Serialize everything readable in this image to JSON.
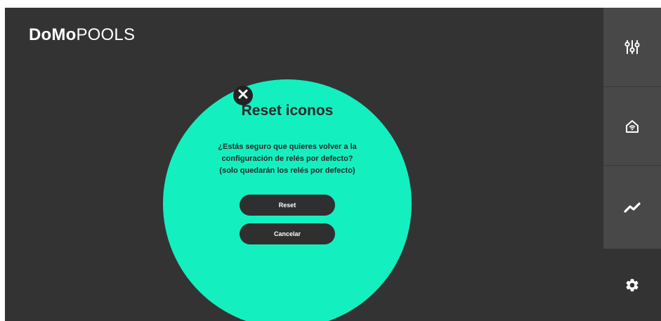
{
  "brand": {
    "bold": "DoMo",
    "light": "POOLS"
  },
  "sidebar": {
    "items": [
      {
        "icon": "sliders-icon"
      },
      {
        "icon": "smart-home-icon"
      },
      {
        "icon": "trend-chart-icon"
      },
      {
        "icon": "gear-icon"
      }
    ]
  },
  "dialog": {
    "title": "Reset iconos",
    "message_lines": [
      "¿Estás seguro que quieres volver a la",
      "configuración de relés por defecto?",
      "(solo quedarán los relés por defecto)"
    ],
    "reset_label": "Reset",
    "cancel_label": "Cancelar"
  },
  "colors": {
    "background": "#333333",
    "sidebar": "#484848",
    "accent": "#14efc0",
    "button": "#2f2f2f"
  }
}
